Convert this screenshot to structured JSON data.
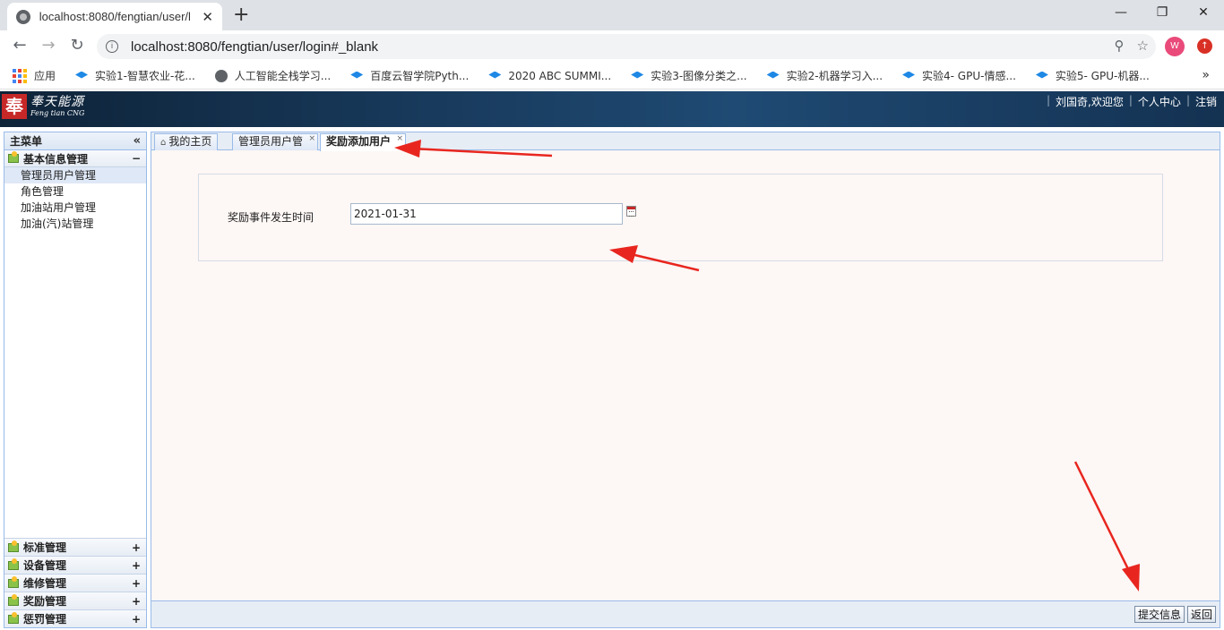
{
  "browser": {
    "tab_title": "localhost:8080/fengtian/user/l",
    "tab_close": "✕",
    "new_tab": "+",
    "url": "localhost:8080/fengtian/user/login#_blank",
    "avatar_letter": "W",
    "window_controls": {
      "minimize": "—",
      "maximize": "❐",
      "close": "✕"
    },
    "bookmarks": [
      {
        "label": "应用",
        "icon": "apps-grid-icon"
      },
      {
        "label": "实验1-智慧农业-花...",
        "icon": "course-icon"
      },
      {
        "label": "人工智能全栈学习...",
        "icon": "globe-icon"
      },
      {
        "label": "百度云智学院Pyth...",
        "icon": "course-icon"
      },
      {
        "label": "2020 ABC SUMMI...",
        "icon": "course-icon"
      },
      {
        "label": "实验3-图像分类之...",
        "icon": "course-icon"
      },
      {
        "label": "实验2-机器学习入...",
        "icon": "course-icon"
      },
      {
        "label": "实验4- GPU-情感...",
        "icon": "course-icon"
      },
      {
        "label": "实验5- GPU-机器...",
        "icon": "course-icon"
      }
    ],
    "bookmarks_more": "»"
  },
  "header": {
    "logo_mark": "奉",
    "logo_cn": "奉天能源",
    "logo_en": "Feng tian CNG",
    "welcome": "刘国奇,欢迎您",
    "profile": "个人中心",
    "logout": "注销",
    "separator": "|"
  },
  "sidebar": {
    "title": "主菜单",
    "collapse": "«",
    "open_section": {
      "label": "基本信息管理",
      "toggle": "−",
      "items": [
        "管理员用户管理",
        "角色管理",
        "加油站用户管理",
        "加油(汽)站管理"
      ]
    },
    "collapsed_sections": [
      {
        "label": "标准管理",
        "toggle": "+"
      },
      {
        "label": "设备管理",
        "toggle": "+"
      },
      {
        "label": "维修管理",
        "toggle": "+"
      },
      {
        "label": "奖励管理",
        "toggle": "+"
      },
      {
        "label": "惩罚管理",
        "toggle": "+"
      }
    ]
  },
  "tabs": [
    {
      "label": "我的主页",
      "closable": false
    },
    {
      "label": "管理员用户管",
      "close": "×"
    },
    {
      "label": "奖励添加用户",
      "close": "×",
      "active": true
    }
  ],
  "form": {
    "label": "奖励事件发生时间",
    "value": "2021-01-31"
  },
  "footer": {
    "submit": "提交信息",
    "back": "返回"
  },
  "colors": {
    "header_bg": "#183a5c",
    "panel_border": "#99bbe8",
    "annotation": "#e8261f",
    "content_bg": "#fdf7f5"
  }
}
